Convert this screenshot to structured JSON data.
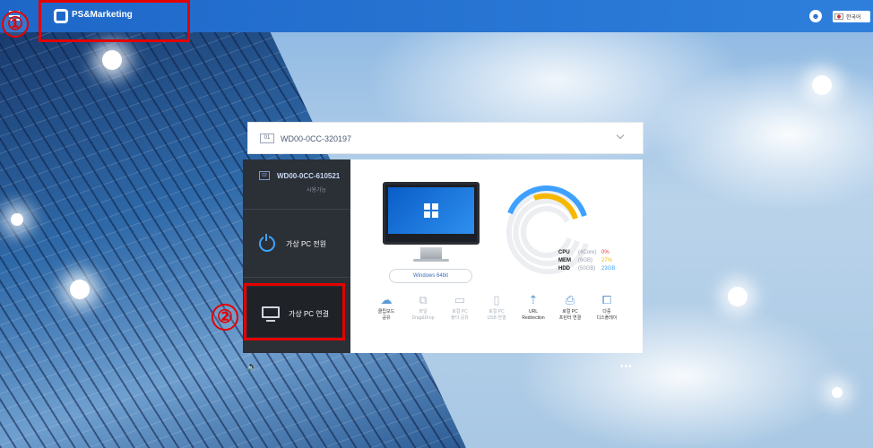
{
  "app": {
    "brand": "PS&Marketing"
  },
  "header": {
    "language": "한국어"
  },
  "selector": {
    "number": "01",
    "name": "WD00-0CC-320197"
  },
  "sidebar": {
    "pc_number": "02",
    "pc_name": "WD00-0CC-610521",
    "status": "사용가능",
    "power_label": "가상 PC 전원",
    "connect_label": "가상 PC 연결"
  },
  "main": {
    "os": "Windows 64bit",
    "stats": [
      {
        "label": "CPU",
        "sub": "(4Core)",
        "value": "0%",
        "color": "#e53935"
      },
      {
        "label": "MEM",
        "sub": "(8GB)",
        "value": "27%",
        "color": "#f5b800"
      },
      {
        "label": "HDD",
        "sub": "(50GB)",
        "value": "23GB",
        "color": "#3ea0ff"
      }
    ],
    "tools": [
      {
        "icon": "cloud-icon",
        "glyph": "☁",
        "label1": "클립보드",
        "label2": "공유",
        "enabled": true
      },
      {
        "icon": "drag-drop-icon",
        "glyph": "⧉",
        "label1": "파일",
        "label2": "Drag&Drop",
        "enabled": false
      },
      {
        "icon": "folder-share-icon",
        "glyph": "▭",
        "label1": "로컬 PC",
        "label2": "폴더 공유",
        "enabled": false
      },
      {
        "icon": "usb-icon",
        "glyph": "▯",
        "label1": "로컬 PC",
        "label2": "USB 연결",
        "enabled": false
      },
      {
        "icon": "url-redirect-icon",
        "glyph": "⇡",
        "label1": "URL",
        "label2": "Redirection",
        "enabled": true
      },
      {
        "icon": "printer-icon",
        "glyph": "⎙",
        "label1": "로컬 PC",
        "label2": "프린터 연결",
        "enabled": true
      },
      {
        "icon": "multi-display-icon",
        "glyph": "⧠",
        "label1": "다중",
        "label2": "디스플레이",
        "enabled": true
      }
    ]
  },
  "annotations": [
    {
      "label": "①"
    },
    {
      "label": "②"
    }
  ],
  "colors": {
    "topbar": "#1e67c8",
    "annotation": "#e40000",
    "cpu": "#e53935",
    "mem": "#f5b800",
    "hdd": "#3ea0ff"
  }
}
